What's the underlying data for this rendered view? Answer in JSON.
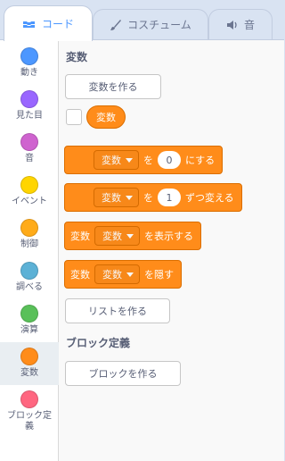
{
  "tabs": [
    {
      "label": "コード",
      "icon": "code-icon"
    },
    {
      "label": "コスチューム",
      "icon": "brush-icon"
    },
    {
      "label": "音",
      "icon": "speaker-icon"
    }
  ],
  "categories": [
    {
      "label": "動き",
      "color": "#4c97ff"
    },
    {
      "label": "見た目",
      "color": "#9966ff"
    },
    {
      "label": "音",
      "color": "#cf63cf"
    },
    {
      "label": "イベント",
      "color": "#ffd500"
    },
    {
      "label": "制御",
      "color": "#ffab19"
    },
    {
      "label": "調べる",
      "color": "#5cb1d6"
    },
    {
      "label": "演算",
      "color": "#59c059"
    },
    {
      "label": "変数",
      "color": "#ff8c1a"
    },
    {
      "label": "ブロック定義",
      "color": "#ff6680"
    }
  ],
  "variables_section": {
    "title": "変数",
    "make_variable_button": "変数を作る",
    "variable_reporter": "変数"
  },
  "blocks": {
    "set": {
      "dropdown": "変数",
      "word1": "を",
      "value": "0",
      "word2": "にする"
    },
    "change": {
      "dropdown": "変数",
      "word1": "を",
      "value": "1",
      "word2": "ずつ変える"
    },
    "show": {
      "prefix": "変数",
      "dropdown": "変数",
      "suffix": "を表示する"
    },
    "hide": {
      "prefix": "変数",
      "dropdown": "変数",
      "suffix": "を隠す"
    }
  },
  "make_list_button": "リストを作る",
  "my_blocks_section": {
    "title": "ブロック定義",
    "make_block_button": "ブロックを作る"
  },
  "colors": {
    "accent": "#4c97ff",
    "variables": "#ff8c1a",
    "variables_border": "#db6e00"
  }
}
